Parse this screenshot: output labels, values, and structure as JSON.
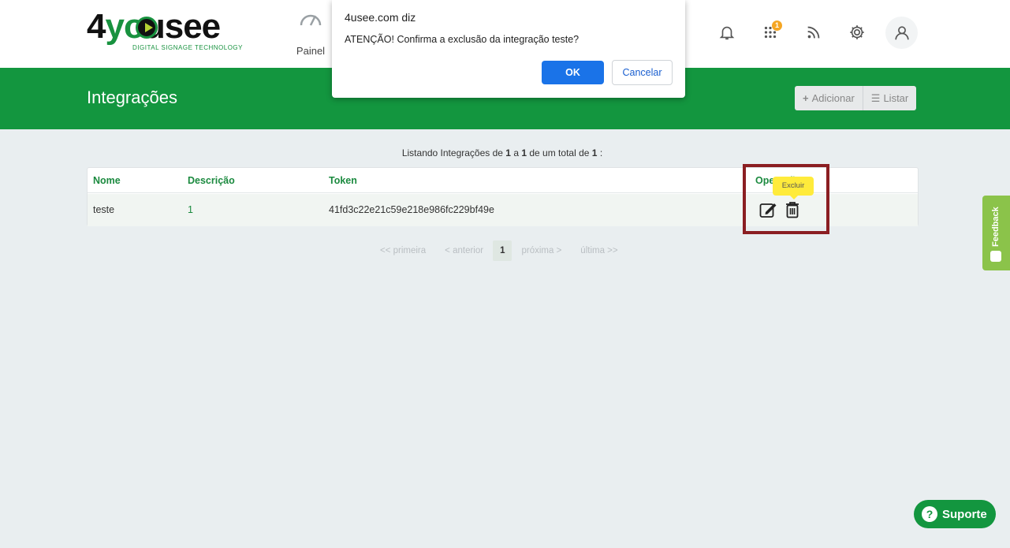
{
  "header": {
    "logo": {
      "text_dark_1": "4",
      "text_green": "yo",
      "text_dark_2": "usee",
      "tagline": "DIGITAL SIGNAGE TECHNOLOGY"
    },
    "nav": {
      "painel_label": "Painel",
      "painel_icon": "gauge-icon"
    },
    "icons": [
      {
        "name": "bell-icon"
      },
      {
        "name": "apps-grid-icon",
        "badge": "1"
      },
      {
        "name": "rss-icon"
      },
      {
        "name": "gear-icon"
      },
      {
        "name": "user-icon"
      }
    ]
  },
  "band": {
    "title": "Integrações",
    "add_label": "Adicionar",
    "list_label": "Listar"
  },
  "listing": {
    "prefix": "Listando Integrações de",
    "from": "1",
    "a": "a",
    "to": "1",
    "mid": "de um total de",
    "total": "1",
    "suffix": ":"
  },
  "table": {
    "headers": {
      "nome": "Nome",
      "descricao": "Descrição",
      "token": "Token",
      "operacoes": "Operações"
    },
    "rows": [
      {
        "nome": "teste",
        "descricao": "1",
        "token": "41fd3c22e21c59e218e986fc229bf49e"
      }
    ],
    "tooltip": "Excluir"
  },
  "pager": {
    "first": "<< primeira",
    "prev": "< anterior",
    "current": "1",
    "next": "próxima >",
    "last": "última >>"
  },
  "dialog": {
    "title": "4usee.com diz",
    "message": "ATENÇÃO! Confirma a exclusão da integração teste?",
    "ok_label": "OK",
    "cancel_label": "Cancelar"
  },
  "feedback": {
    "label": "Feedback"
  },
  "suporte": {
    "label": "Suporte",
    "icon": "?"
  },
  "colors": {
    "brand_green": "#13963f",
    "dialog_blue": "#1a73e8",
    "highlight": "#8b1e22",
    "tooltip": "#ffeb3b"
  }
}
